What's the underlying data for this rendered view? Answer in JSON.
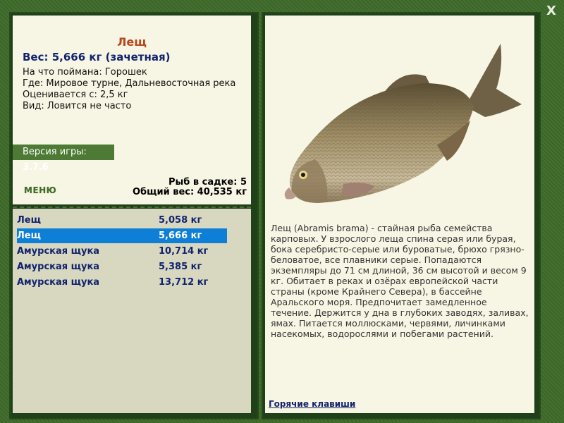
{
  "fish": {
    "name": "Лещ",
    "weight_line": "Вес: 5,666 кг (зачетная)",
    "caught_with": "На что поймана: Горошек",
    "location": "Где: Мировое турне, Дальневосточная река",
    "rated_from": "Оценивается с: 2,5 кг",
    "kind": "Вид: Ловится не часто"
  },
  "version": {
    "label": "Версия игры:",
    "value": "3.7.6"
  },
  "menu": {
    "label": "МЕНЮ"
  },
  "stats": {
    "in_cage": "Рыб в садке: 5",
    "total_weight": "Общий вес: 40,535 кг"
  },
  "catch_list": [
    {
      "name": "Лещ",
      "weight": "5,058 кг",
      "selected": false
    },
    {
      "name": "Лещ",
      "weight": "5,666 кг",
      "selected": true
    },
    {
      "name": "Амурская щука",
      "weight": "10,714 кг",
      "selected": false
    },
    {
      "name": "Амурская щука",
      "weight": "5,385 кг",
      "selected": false
    },
    {
      "name": "Амурская щука",
      "weight": "13,712 кг",
      "selected": false
    }
  ],
  "description": "Лещ (Abramis brama) - стайная рыба семейства карповых. У взрослого леща спина серая или бурая, бока серебристо-серые или буроватые, брюхо грязно-беловатое, все плавники серые. Попадаются экземпляры до 71 см длиной, 36 см высотой и весом 9 кг. Обитает в реках и озёрах европейской части страны (кроме Крайнего Севера), в бассейне Аральского моря. Предпочитает замедленное течение. Держится у дна в глубоких заводях, заливах, ямах. Питается моллюсками, червями, личинками насекомых, водорослями и побегами растений.",
  "hotkeys": {
    "label": "Горячие клавиши"
  },
  "close": {
    "label": "X"
  },
  "colors": {
    "accent": "#b6471c",
    "selected_row": "#0e7fd6",
    "frame": "#3d6a2a",
    "panel": "#f7f5e3"
  }
}
